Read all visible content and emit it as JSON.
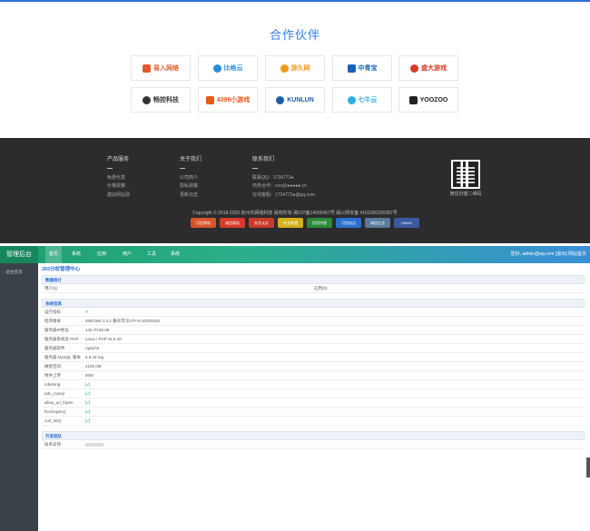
{
  "partners": {
    "title": "合作伙伴",
    "logos": [
      {
        "name": "易入网络",
        "color": "#e05a2b"
      },
      {
        "name": "比格云",
        "color": "#2a8ce0"
      },
      {
        "name": "游久网",
        "color": "#f29a1a"
      },
      {
        "name": "中青宝",
        "color": "#1a5fb8"
      },
      {
        "name": "盛大游戏",
        "color": "#d83a2a"
      },
      {
        "name": "畅控科技",
        "color": "#333333"
      },
      {
        "name": "4399小游戏",
        "color": "#e8591a"
      },
      {
        "name": "KUNLUN",
        "color": "#1e5aa8"
      },
      {
        "name": "七牛云",
        "color": "#2ab0e0"
      },
      {
        "name": "YOOZOO",
        "color": "#222222"
      }
    ]
  },
  "footer": {
    "col1": {
      "title": "产品服务",
      "items": [
        "免费代发",
        "价格政策",
        "建站网站源"
      ]
    },
    "col2": {
      "title": "关于我们",
      "items": [
        "公司简介",
        "隐私政策",
        "更新日志"
      ]
    },
    "col3": {
      "title": "联系我们",
      "items": [
        "联系QQ：1734773●",
        "商务合作：ceo@●●●●●.cn",
        "在线客服：1734773●@qq.com"
      ]
    },
    "qr_label": "微信扫描二维码",
    "copyright": "Copyright © 2018-2020 泉州市网络科技 版权所有 闽ICP备14000457号  闽公网安备 4101050200287号",
    "badges": [
      {
        "label": "可信网站",
        "color": "#d8542a"
      },
      {
        "label": "诚信网站",
        "color": "#d83a2a"
      },
      {
        "label": "实名认证",
        "color": "#c83a2a"
      },
      {
        "label": "安全联盟",
        "color": "#d4b01a"
      },
      {
        "label": "信用中国",
        "color": "#2a8a3a"
      },
      {
        "label": "可信站点",
        "color": "#2a6fd0"
      },
      {
        "label": "诚信企业",
        "color": "#5a7a9a"
      },
      {
        "label": "CNNIC",
        "color": "#3a5aa0"
      }
    ]
  },
  "admin": {
    "brand": "管理后台",
    "nav": [
      "首页",
      "系统",
      "应用",
      "用户",
      "工具",
      "系统"
    ],
    "user": "您好, admin@qq.com [退出]   网站首页",
    "sidebar_item": "› 后台首页",
    "crumb": "265分权管理中心",
    "section1": {
      "title": "数据统计",
      "user_label": "用户(1)",
      "app_label": "应用(0)"
    },
    "section2": {
      "title": "系统信息",
      "rows": [
        {
          "label": "运行指标",
          "value": "✔",
          "kind": "ok"
        },
        {
          "label": "程序版本",
          "value": "265CMS 1.0.2 重庆市汉UTF-8 20200220",
          "kind": "text"
        },
        {
          "label": "服务器IP地址",
          "value": "140.70.55.89",
          "kind": "text"
        },
        {
          "label": "服务器系统及 PHP",
          "value": "Linux / PHP v5.6.40",
          "kind": "text"
        },
        {
          "label": "服务器软件",
          "value": "Apache",
          "kind": "text"
        },
        {
          "label": "服务器 MySQL 版本",
          "value": "5.6.44-log",
          "kind": "text"
        },
        {
          "label": "磁盘空间",
          "value": "4100.0M",
          "kind": "text"
        },
        {
          "label": "附件上传",
          "value": "50M",
          "kind": "text"
        },
        {
          "label": "mbstring",
          "value": "[√]",
          "kind": "green"
        },
        {
          "label": "pdo_mysql",
          "value": "[√]",
          "kind": "green"
        },
        {
          "label": "allow_url_fopen",
          "value": "[√]",
          "kind": "green"
        },
        {
          "label": "fsockopen()",
          "value": "[√]",
          "kind": "green"
        },
        {
          "label": "curl_init()",
          "value": "[√]",
          "kind": "green"
        }
      ]
    },
    "section3": {
      "title": "开发团队",
      "row_label": "技术支持"
    }
  }
}
